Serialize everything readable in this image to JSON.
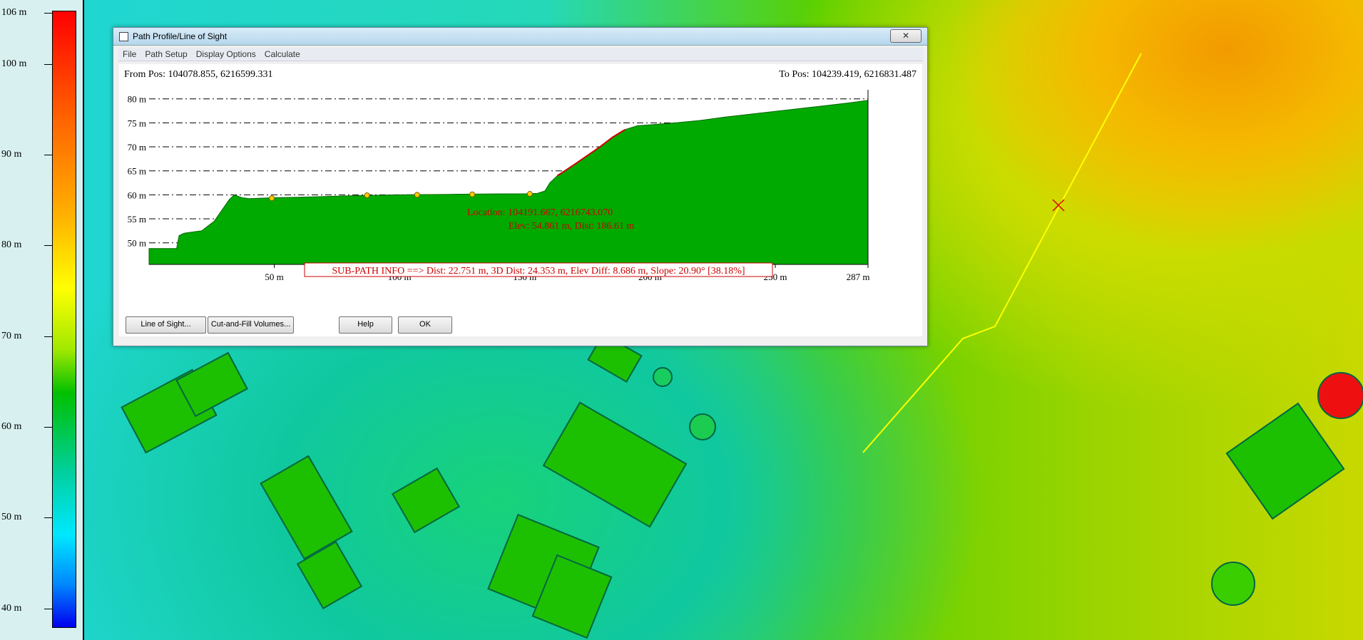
{
  "legend": {
    "title_max": "106 m",
    "labels": [
      "106 m",
      "100 m",
      "90 m",
      "80 m",
      "70 m",
      "60 m",
      "50 m",
      "40 m"
    ],
    "colors": {
      "high": "#ff0000",
      "mid": "#ffff00",
      "low": "#0000ee"
    }
  },
  "dialog": {
    "title": "Path Profile/Line of Sight",
    "close_label": "✕",
    "menu": [
      "File",
      "Path Setup",
      "Display Options",
      "Calculate"
    ],
    "from_pos": "From Pos: 104078.855, 6216599.331",
    "to_pos": "To Pos: 104239.419, 6216831.487",
    "cursor_location": "Location: 104191.667, 6216743.070",
    "cursor_elev": "Elev: 54.861 m, Dist: 186.61 m",
    "subpath_info": "SUB-PATH INFO ==> Dist: 22.751 m, 3D Dist: 24.353 m, Elev Diff: 8.686 m, Slope: 20.90° [38.18%]",
    "buttons": {
      "line_of_sight": "Line of Sight...",
      "cut_fill": "Cut-and-Fill Volumes...",
      "help": "Help",
      "ok": "OK"
    }
  },
  "chart_data": {
    "type": "area",
    "xlabel": "",
    "ylabel": "",
    "x_ticks": [
      "50 m",
      "100 m",
      "150 m",
      "200 m",
      "250 m",
      "287 m"
    ],
    "x_tick_values": [
      50,
      100,
      150,
      200,
      250,
      287
    ],
    "y_ticks": [
      "80 m",
      "75 m",
      "70 m",
      "65 m",
      "60 m",
      "55 m",
      "50 m"
    ],
    "y_tick_values": [
      80,
      75,
      70,
      65,
      60,
      55,
      50
    ],
    "xlim": [
      0,
      287
    ],
    "ylim": [
      45.5,
      81
    ],
    "grid": true,
    "series": [
      {
        "fill": "#00aa00",
        "x": [
          0,
          11,
          12,
          14,
          18,
          21,
          26,
          30,
          32,
          34,
          37,
          40,
          50,
          60,
          80,
          100,
          120,
          140,
          150,
          155,
          158,
          160,
          163,
          166,
          170,
          175,
          180,
          185,
          190,
          195,
          200,
          210,
          220,
          230,
          240,
          250,
          260,
          270,
          280,
          287
        ],
        "y": [
          48.8,
          48.8,
          51.5,
          52.0,
          52.3,
          52.5,
          54.5,
          57.5,
          59.0,
          60.0,
          59.4,
          59.2,
          59.4,
          59.5,
          59.8,
          60.0,
          60.1,
          60.2,
          60.2,
          60.3,
          60.8,
          62.5,
          64.0,
          65.0,
          66.4,
          68.2,
          70.0,
          72.0,
          73.6,
          74.4,
          74.6,
          75.0,
          75.5,
          76.2,
          76.8,
          77.4,
          78.0,
          78.6,
          79.2,
          79.7
        ]
      }
    ],
    "highlight_segment": {
      "color": "#cc0000",
      "x": [
        163,
        190
      ]
    },
    "markers": {
      "color": "#ffcc00",
      "x": [
        49,
        87,
        107,
        129,
        152
      ],
      "y": [
        59.3,
        59.9,
        60.0,
        60.1,
        60.2
      ]
    }
  }
}
